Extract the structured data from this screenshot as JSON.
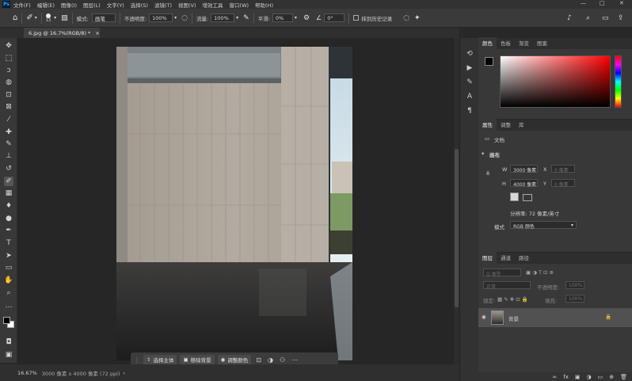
{
  "app": {
    "logo": "Ps"
  },
  "menu": [
    "文件(F)",
    "编辑(E)",
    "图像(I)",
    "图层(L)",
    "文字(Y)",
    "选择(S)",
    "滤镜(T)",
    "视图(V)",
    "增效工具",
    "窗口(W)",
    "帮助(H)"
  ],
  "window_controls": {
    "minimize": "—",
    "maximize": "□",
    "close": "✕"
  },
  "options": {
    "brush_size": "13",
    "mode_label": "模式:",
    "mode_value": "画笔",
    "opacity_label": "不透明度:",
    "opacity_value": "100%",
    "flow_label": "流量:",
    "flow_value": "100%",
    "smooth_label": "平滑:",
    "smooth_value": "0%",
    "angle_value": "0°",
    "history_label": "抹到历史记录"
  },
  "document_tab": {
    "title": "6.jpg @ 16.7%(RGB/8) *",
    "close": "×"
  },
  "taskbar": {
    "select_subject": "选择主体",
    "remove_bg": "移除背景",
    "adjust_color": "调整颜色"
  },
  "status": {
    "zoom": "16.67%",
    "info": "3000 像素 x 4000 像素 (72 ppi)"
  },
  "color_panel": {
    "tabs": [
      "颜色",
      "色板",
      "渐变",
      "图案"
    ],
    "foreground": "#000000",
    "background": "#ffffff"
  },
  "properties_panel": {
    "tabs": [
      "属性",
      "调整",
      "库"
    ],
    "doc_label": "文档",
    "canvas_label": "画布",
    "w_label": "W",
    "w_value": "3000 像素",
    "h_label": "H",
    "h_value": "4000 像素",
    "x_label": "X",
    "x_value": "0 像素",
    "y_label": "Y",
    "y_value": "0 像素",
    "resolution": "分辨率: 72 像素/英寸",
    "mode_label": "模式",
    "mode_value": "RGB 颜色"
  },
  "layers_panel": {
    "tabs": [
      "图层",
      "通道",
      "路径"
    ],
    "filter_label": "Q 类型",
    "blend_value": "正常",
    "opacity_label": "不透明度:",
    "opacity_value": "100%",
    "lock_label": "锁定:",
    "fill_label": "填充:",
    "fill_value": "100%",
    "layer_name": "背景"
  }
}
